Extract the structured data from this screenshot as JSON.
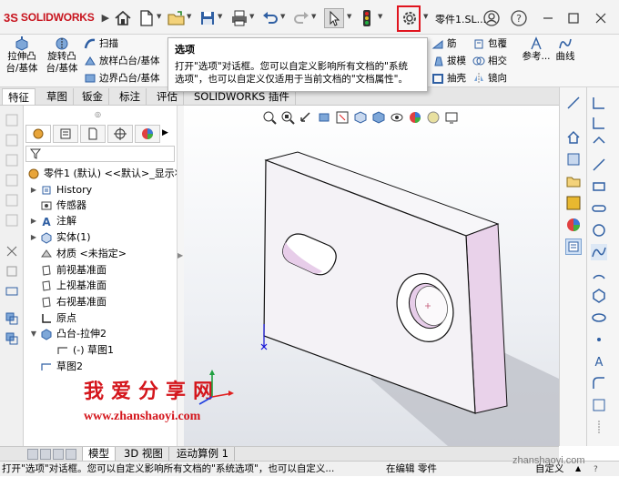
{
  "app": {
    "logo_ds": "3S",
    "logo_name": "SOLIDWORKS",
    "doc_title": "零件1.SL..."
  },
  "tooltip": {
    "title": "选项",
    "line1": "打开\"选项\"对话框。您可以自定义影响所有文档的\"系统",
    "line2": "选项\"，也可以自定义仅适用于当前文档的\"文档属性\"。"
  },
  "commands": {
    "extrude_boss": "拉伸凸",
    "extrude_boss2": "台/基体",
    "revolve_boss": "旋转凸",
    "revolve_boss2": "台/基体",
    "sweep": "扫描",
    "loft": "放样凸台/基体",
    "boundary": "边界凸台/基体",
    "rib": "筋",
    "wrap": "包覆",
    "draft": "拔模",
    "intersect": "相交",
    "shell": "抽壳",
    "mirror": "镜向",
    "reference": "参考...",
    "curves": "曲线"
  },
  "tabs": [
    "特征",
    "草图",
    "钣金",
    "标注",
    "评估",
    "SOLIDWORKS 插件"
  ],
  "tree": {
    "root": "零件1 (默认) <<默认>_显示状",
    "items": [
      {
        "label": "History",
        "exp": "▶"
      },
      {
        "label": "传感器",
        "exp": ""
      },
      {
        "label": "注解",
        "exp": "▶"
      },
      {
        "label": "实体(1)",
        "exp": "▶"
      },
      {
        "label": "材质 <未指定>",
        "exp": ""
      },
      {
        "label": "前视基准面",
        "exp": ""
      },
      {
        "label": "上视基准面",
        "exp": ""
      },
      {
        "label": "右视基准面",
        "exp": ""
      },
      {
        "label": "原点",
        "exp": ""
      },
      {
        "label": "凸台-拉伸2",
        "exp": "▼"
      },
      {
        "label": "(-) 草图1",
        "exp": ""
      },
      {
        "label": "草图2",
        "exp": ""
      }
    ]
  },
  "watermark": {
    "cn": "我爱分享网",
    "url": "www.zhanshaoyi.com",
    "corner": "zhanshaoyi.com"
  },
  "bottom_tabs": [
    "模型",
    "3D 视图",
    "运动算例 1"
  ],
  "status": {
    "message": "打开\"选项\"对话框。您可以自定义影响所有文档的\"系统选项\"，也可以自定义...",
    "mode": "在编辑 零件",
    "custom": "自定义"
  },
  "colors": {
    "brand": "#c8141e",
    "highlight": "#e0141e",
    "part_face": "#f4f2f6",
    "part_edge": "#d7c2db"
  }
}
